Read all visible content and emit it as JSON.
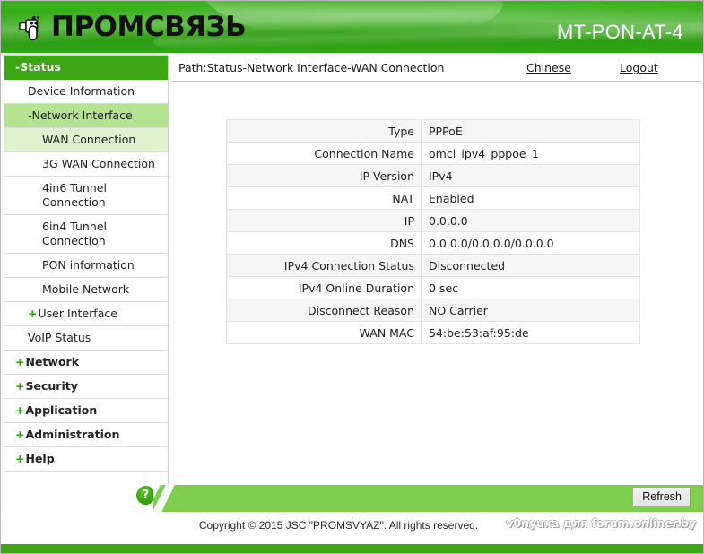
{
  "header": {
    "brand": "ПРОМСВЯЗЬ",
    "logo_icon": "plug-connector-icon",
    "model": "MT-PON-AT-4"
  },
  "sidebar": {
    "items": [
      {
        "label": "-Status",
        "level": "top",
        "state": "sel-dark",
        "icon": ""
      },
      {
        "label": "Device Information",
        "level": "lvl2",
        "state": "",
        "icon": ""
      },
      {
        "label": "-Network Interface",
        "level": "lvl2",
        "state": "sel-mid",
        "icon": ""
      },
      {
        "label": "WAN Connection",
        "level": "lvl3",
        "state": "sel-light",
        "icon": ""
      },
      {
        "label": "3G WAN Connection",
        "level": "lvl3",
        "state": "",
        "icon": ""
      },
      {
        "label": "4in6 Tunnel Connection",
        "level": "lvl3",
        "state": "",
        "icon": ""
      },
      {
        "label": "6in4 Tunnel Connection",
        "level": "lvl3",
        "state": "",
        "icon": ""
      },
      {
        "label": "PON information",
        "level": "lvl3",
        "state": "",
        "icon": ""
      },
      {
        "label": "Mobile Network",
        "level": "lvl3",
        "state": "",
        "icon": ""
      },
      {
        "label": "User Interface",
        "level": "lvl2",
        "state": "",
        "icon": "+"
      },
      {
        "label": "VoIP Status",
        "level": "lvl2",
        "state": "",
        "icon": ""
      },
      {
        "label": "Network",
        "level": "top",
        "state": "",
        "icon": "+"
      },
      {
        "label": "Security",
        "level": "top",
        "state": "",
        "icon": "+"
      },
      {
        "label": "Application",
        "level": "top",
        "state": "",
        "icon": "+"
      },
      {
        "label": "Administration",
        "level": "top",
        "state": "",
        "icon": "+"
      },
      {
        "label": "Help",
        "level": "top",
        "state": "",
        "icon": "+"
      }
    ],
    "help_badge": "?"
  },
  "pathbar": {
    "path": "Path:Status-Network Interface-WAN Connection",
    "chinese_label": "Chinese",
    "logout_label": "Logout"
  },
  "table": {
    "rows": [
      {
        "key": "Type",
        "value": "PPPoE"
      },
      {
        "key": "Connection Name",
        "value": "omci_ipv4_pppoe_1"
      },
      {
        "key": "IP Version",
        "value": "IPv4"
      },
      {
        "key": "NAT",
        "value": "Enabled"
      },
      {
        "key": "IP",
        "value": "0.0.0.0"
      },
      {
        "key": "DNS",
        "value": "0.0.0.0/0.0.0.0/0.0.0.0"
      },
      {
        "key": "IPv4 Connection Status",
        "value": "Disconnected"
      },
      {
        "key": "IPv4 Online Duration",
        "value": "0 sec"
      },
      {
        "key": "Disconnect Reason",
        "value": "NO Carrier"
      },
      {
        "key": "WAN MAC",
        "value": "54:be:53:af:95:de"
      }
    ]
  },
  "footer": {
    "refresh_label": "Refresh",
    "copyright": "Copyright © 2015 JSC \"PROMSVYAZ\". All rights reserved.",
    "watermark": "v0nyuxa для forum.onliner.by"
  },
  "colors": {
    "brand_green": "#3ba513",
    "header_green": "#34a715",
    "footer_green": "#7fce4e",
    "sel_mid": "#b4e491",
    "sel_light": "#dff2cf"
  }
}
